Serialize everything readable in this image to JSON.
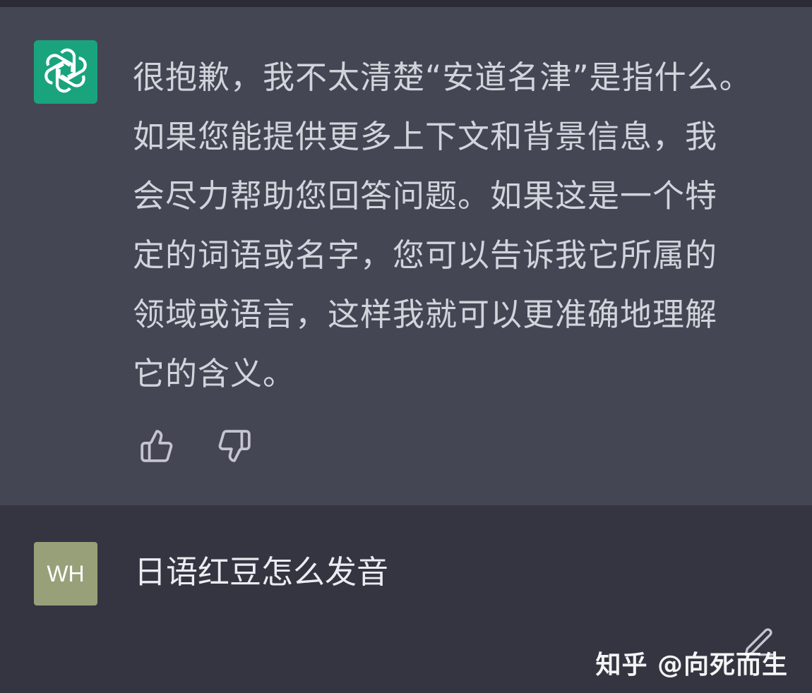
{
  "assistant": {
    "avatar_icon": "openai-logo-icon",
    "avatar_color": "#19a47e",
    "message": "很抱歉，我不太清楚“安道名津”是指什么。\n如果您能提供更多上下文和背景信息，我\n会尽力帮助您回答问题。如果这是一个特\n定的词语或名字，您可以告诉我它所属的\n领域或语言，这样我就可以更准确地理解\n它的含义。",
    "feedback": {
      "thumbs_up_icon": "thumbs-up-icon",
      "thumbs_down_icon": "thumbs-down-icon"
    }
  },
  "user": {
    "avatar_initials": "WH",
    "avatar_color": "#98a07a",
    "message": "日语红豆怎么发音",
    "edit_icon": "edit-icon"
  },
  "watermark": "知乎 @向死而生",
  "colors": {
    "assistant_bg": "#444654",
    "user_bg": "#343541",
    "text": "#d1d5db"
  }
}
